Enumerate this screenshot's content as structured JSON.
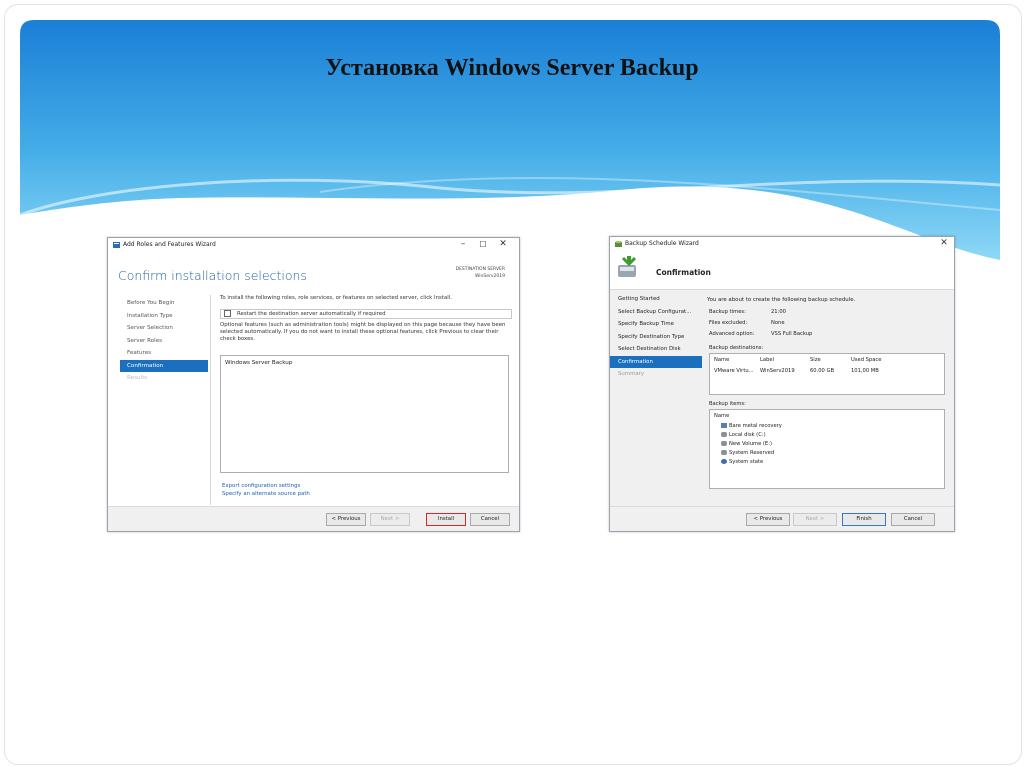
{
  "slide": {
    "title": "Установка Windows Server Backup"
  },
  "colors": {
    "banner_top": "#1a7fd6",
    "banner_bottom": "#7fd0f2",
    "accent_blue": "#1c6fbf",
    "install_highlight": "#d62828"
  },
  "wizard1": {
    "window_title": "Add Roles and Features Wizard",
    "heading": "Confirm installation selections",
    "destination_label": "DESTINATION SERVER",
    "destination_server": "WinServ2019",
    "nav": [
      "Before You Begin",
      "Installation Type",
      "Server Selection",
      "Server Roles",
      "Features",
      "Confirmation",
      "Results"
    ],
    "instruction": "To install the following roles, role services, or features on selected server, click Install.",
    "restart_checkbox": "Restart the destination server automatically if required",
    "optional_note": "Optional features (such as administration tools) might be displayed on this page because they have been selected automatically. If you do not want to install these optional features, click Previous to clear their check boxes.",
    "selected_feature": "Windows Server Backup",
    "export_link": "Export configuration settings",
    "alt_source_link": "Specify an alternate source path",
    "buttons": {
      "previous": "< Previous",
      "next": "Next >",
      "install": "Install",
      "cancel": "Cancel"
    }
  },
  "wizard2": {
    "window_title": "Backup Schedule Wizard",
    "heading": "Confirmation",
    "nav": [
      "Getting Started",
      "Select Backup Configurat...",
      "Specify Backup Time",
      "Specify Destination Type",
      "Select Destination Disk",
      "Confirmation",
      "Summary"
    ],
    "intro": "You are about to create the following backup schedule.",
    "details": [
      {
        "key": "Backup times:",
        "value": "21:00"
      },
      {
        "key": "Files excluded:",
        "value": "None"
      },
      {
        "key": "Advanced option:",
        "value": "VSS Full Backup"
      }
    ],
    "destinations_label": "Backup destinations:",
    "destinations_columns": [
      "Name",
      "Label",
      "Size",
      "Used Space"
    ],
    "destinations_row": [
      "VMware Virtu...",
      "WinServ2019",
      "60,00 GB",
      "101,00 MB"
    ],
    "items_label": "Backup items:",
    "items_column": "Name",
    "items": [
      "Bare metal recovery",
      "Local disk (C:)",
      "New Volume (E:)",
      "System Reserved",
      "System state"
    ],
    "buttons": {
      "previous": "< Previous",
      "next": "Next >",
      "finish": "Finish",
      "cancel": "Cancel"
    }
  }
}
